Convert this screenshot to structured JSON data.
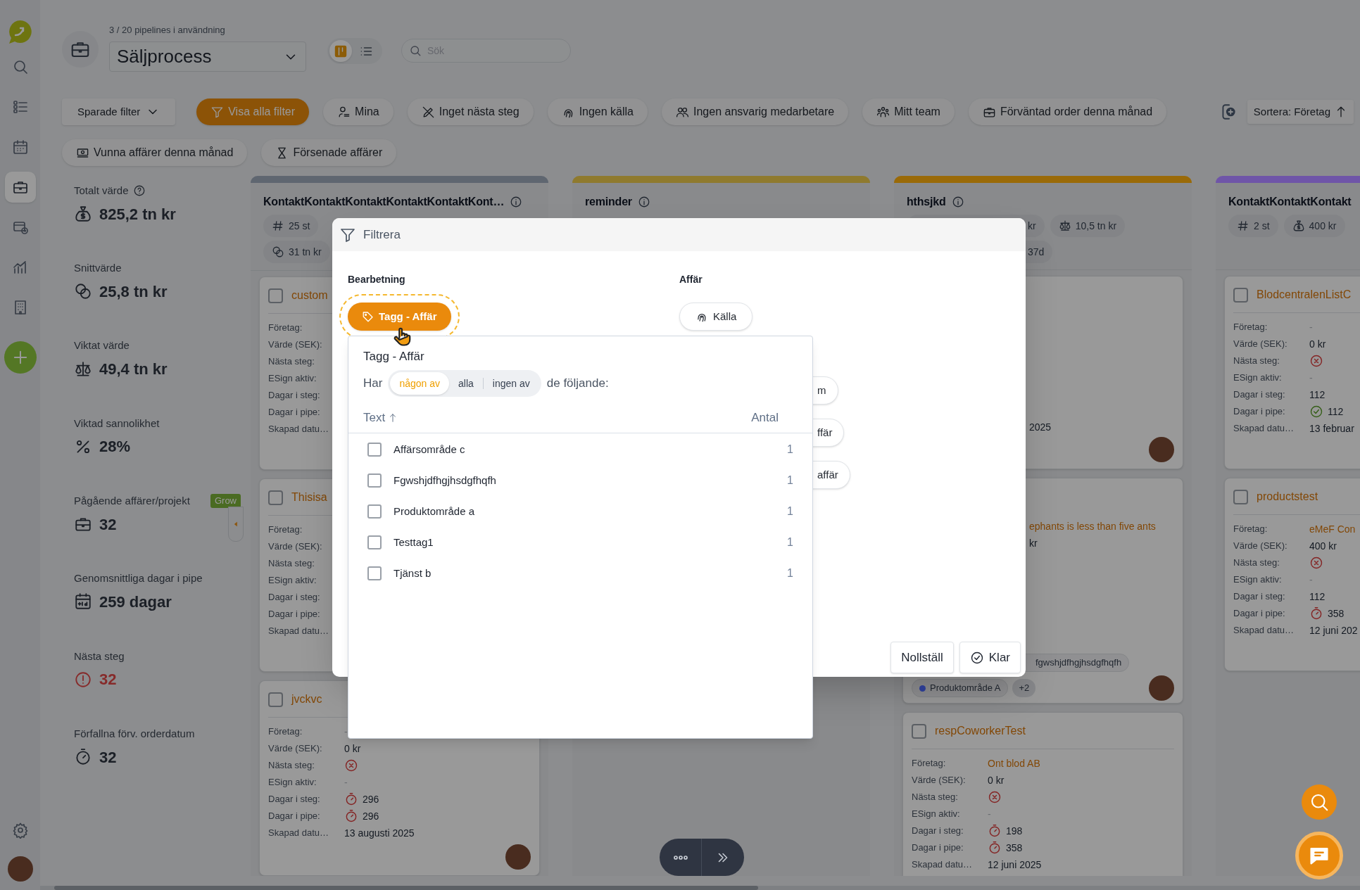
{
  "nav": {
    "items": [
      {
        "kind": "search",
        "selected": false
      },
      {
        "kind": "tasks",
        "selected": false
      },
      {
        "kind": "calendar",
        "selected": false
      },
      {
        "kind": "pipeline",
        "selected": true
      },
      {
        "kind": "mail",
        "selected": false
      },
      {
        "kind": "reports",
        "selected": false
      },
      {
        "kind": "companies",
        "selected": false
      }
    ]
  },
  "header": {
    "usage": "3 / 20 pipelines i användning",
    "pipeline": "Säljprocess",
    "views": [
      {
        "kind": "board",
        "selected": true
      },
      {
        "kind": "list",
        "selected": false
      }
    ],
    "search": {
      "placeholder": "Sök"
    }
  },
  "filter_rows": [
    {
      "chips": [
        {
          "kind": "saved",
          "label": "Sparade filter",
          "selected": false
        },
        {
          "kind": "all",
          "label": "Visa alla filter",
          "selected": true
        },
        {
          "kind": "mine",
          "label": "Mina",
          "selected": false
        },
        {
          "kind": "no_step",
          "label": "Inget nästa steg",
          "selected": false
        },
        {
          "kind": "no_source",
          "label": "Ingen källa",
          "selected": false
        },
        {
          "kind": "no_owner",
          "label": "Ingen ansvarig medarbetare",
          "selected": false
        },
        {
          "kind": "team",
          "label": "Mitt team",
          "selected": false
        },
        {
          "kind": "expected",
          "label": "Förväntad order denna månad",
          "selected": false
        }
      ]
    },
    {
      "chips": [
        {
          "kind": "won",
          "label": "Vunna affärer denna månad",
          "selected": false
        },
        {
          "kind": "late",
          "label": "Försenade affärer",
          "selected": false
        }
      ]
    }
  ],
  "sort": {
    "label": "Sortera: Företag"
  },
  "stats": [
    {
      "kind": "total",
      "label": "Totalt värde",
      "value": "825,2 tn kr",
      "help": true
    },
    {
      "kind": "avg",
      "label": "Snittvärde",
      "value": "25,8 tn kr",
      "help": false
    },
    {
      "kind": "weighted",
      "label": "Viktat värde",
      "value": "49,4 tn kr",
      "help": false
    },
    {
      "kind": "probability",
      "label": "Viktad sannolikhet",
      "value": "28%",
      "help": false
    },
    {
      "kind": "ongoing",
      "label": "Pågående affärer/projekt",
      "value": "32",
      "help": false,
      "badge": "Grow"
    },
    {
      "kind": "days",
      "label": "Genomsnittliga dagar i pipe",
      "value": "259 dagar",
      "help": false
    },
    {
      "kind": "next_step",
      "label": "Nästa steg",
      "value": "32",
      "help": false
    },
    {
      "kind": "overdue",
      "label": "Förfallna förv. orderdatum",
      "value": "32",
      "help": false
    }
  ],
  "columns": [
    {
      "title": "KontaktKontaktKontaktKontaktKontaktKont…",
      "info": true,
      "color": "#5f6670",
      "chip_rows": [
        {
          "chips": [
            {
              "kind": "count",
              "text": "25 st"
            }
          ]
        },
        {
          "chips": [
            {
              "kind": "avg",
              "text": "31 tn kr"
            }
          ]
        }
      ],
      "cards": [
        {
          "kind": "deal",
          "title": "custom",
          "checked": false,
          "avatar": false,
          "fields": [
            {
              "label": "Företag:"
            },
            {
              "label": "Värde (SEK):"
            },
            {
              "label": "Nästa steg:"
            },
            {
              "label": "ESign aktiv:"
            },
            {
              "label": "Dagar i steg:"
            },
            {
              "label": "Dagar i pipe:"
            },
            {
              "label": "Skapad datu…"
            }
          ]
        },
        {
          "kind": "deal",
          "title": "Thisisa",
          "checked": false,
          "avatar": false,
          "fields": [
            {
              "label": "Företag:"
            },
            {
              "label": "Värde (SEK):"
            },
            {
              "label": "Nästa steg:"
            },
            {
              "label": "ESign aktiv:"
            },
            {
              "label": "Dagar i steg:"
            },
            {
              "label": "Dagar i pipe:"
            },
            {
              "label": "Skapad datu…"
            }
          ]
        },
        {
          "kind": "deal",
          "title": "jvckvc",
          "checked": false,
          "avatar": true,
          "fields": [
            {
              "label": "Företag:",
              "kind": "muted",
              "value": "-"
            },
            {
              "label": "Värde (SEK):",
              "kind": "text",
              "value": "0 kr"
            },
            {
              "label": "Nästa steg:",
              "kind": "missing"
            },
            {
              "label": "ESign aktiv:",
              "kind": "muted",
              "value": "-"
            },
            {
              "label": "Dagar i steg:",
              "kind": "late",
              "value": "296"
            },
            {
              "label": "Dagar i pipe:",
              "kind": "late",
              "value": "296"
            },
            {
              "label": "Skapad datu…",
              "kind": "text",
              "value": "13 augusti 2025"
            }
          ]
        }
      ]
    },
    {
      "title": "reminder",
      "info": true,
      "color": "#8f7a2e"
    },
    {
      "title": "hthsjkd",
      "info": true,
      "color": "#9a6a08",
      "chip_rows": [
        {
          "chips": [
            {
              "kind": "cut",
              "text": "kr"
            },
            {
              "kind": "weighted",
              "text": "10,5 tn kr"
            }
          ]
        },
        {
          "chips": [
            {
              "kind": "cut",
              "text": "37d"
            }
          ]
        }
      ],
      "cards": [
        {
          "kind": "covered",
          "tail": "2025",
          "avatar": true
        },
        {
          "kind": "covered",
          "lines": [
            {
              "kind": "link",
              "text": "ephants is less than five ants"
            },
            {
              "kind": "text",
              "text": "kr"
            }
          ],
          "tag_rows": [
            {
              "tags": [
                {
                  "kind": "cut",
                  "text": "fgwshjdfhgjhsdgfhqfh"
                }
              ]
            },
            {
              "tags": [
                {
                  "kind": "dot",
                  "text": "Produktområde A",
                  "color": "#2b3b8f"
                },
                {
                  "kind": "more",
                  "text": "+2"
                }
              ]
            }
          ],
          "avatar": true
        },
        {
          "kind": "deal",
          "title": "respCoworkerTest",
          "checked": false,
          "avatar": false,
          "fields": [
            {
              "label": "Företag:",
              "kind": "link",
              "value": "Ont blod AB"
            },
            {
              "label": "Värde (SEK):",
              "kind": "text",
              "value": "0 kr"
            },
            {
              "label": "Nästa steg:",
              "kind": "missing"
            },
            {
              "label": "ESign aktiv:",
              "kind": "muted",
              "value": "-"
            },
            {
              "label": "Dagar i steg:",
              "kind": "late",
              "value": "198"
            },
            {
              "label": "Dagar i pipe:",
              "kind": "late",
              "value": "358"
            },
            {
              "label": "Skapad datu…",
              "kind": "text",
              "value": "12 juni 2025"
            }
          ]
        }
      ]
    },
    {
      "title": "KontaktKontaktKontakt",
      "info": false,
      "color": "#6f55a8",
      "chip_rows": [
        {
          "chips": [
            {
              "kind": "count",
              "text": "2 st"
            },
            {
              "kind": "value",
              "text": "400 kr"
            }
          ]
        }
      ],
      "cards": [
        {
          "kind": "deal",
          "title": "BlodcentralenListC",
          "checked": false,
          "avatar": false,
          "fields": [
            {
              "label": "Företag:",
              "kind": "muted",
              "value": "-"
            },
            {
              "label": "Värde (SEK):",
              "kind": "text",
              "value": "0 kr"
            },
            {
              "label": "Nästa steg:",
              "kind": "missing"
            },
            {
              "label": "ESign aktiv:",
              "kind": "muted",
              "value": "-"
            },
            {
              "label": "Dagar i steg:",
              "kind": "text",
              "value": "112"
            },
            {
              "label": "Dagar i pipe:",
              "kind": "ok",
              "value": "112"
            },
            {
              "label": "Skapad datu…",
              "kind": "text",
              "value": "13 februar"
            }
          ]
        },
        {
          "kind": "deal",
          "title": "productstest",
          "checked": false,
          "avatar": false,
          "fields": [
            {
              "label": "Företag:",
              "kind": "link",
              "value": "eMeF Con"
            },
            {
              "label": "Värde (SEK):",
              "kind": "text",
              "value": "400 kr"
            },
            {
              "label": "Nästa steg:",
              "kind": "missing"
            },
            {
              "label": "ESign aktiv:",
              "kind": "muted",
              "value": "-"
            },
            {
              "label": "Dagar i steg:",
              "kind": "text",
              "value": "112"
            },
            {
              "label": "Dagar i pipe:",
              "kind": "late",
              "value": "358"
            },
            {
              "label": "Skapad datu…",
              "kind": "text",
              "value": "12 juni 202"
            }
          ]
        }
      ]
    }
  ],
  "filter_dialog": {
    "title": "Filtrera",
    "sections": [
      {
        "heading": "Bearbetning",
        "chips": [
          {
            "kind": "tag",
            "label": "Tagg - Affär",
            "selected": true
          }
        ]
      },
      {
        "heading": "Affär",
        "chips": [
          {
            "kind": "source",
            "label": "Källa",
            "selected": false
          },
          {
            "kind": "cut",
            "label": "m",
            "selected": false
          },
          {
            "kind": "cut",
            "label": "ffär",
            "selected": false
          },
          {
            "kind": "cut",
            "label": "affär",
            "selected": false
          }
        ]
      }
    ],
    "buttons": [
      {
        "kind": "reset",
        "label": "Nollställ"
      },
      {
        "kind": "done",
        "label": "Klar"
      }
    ]
  },
  "tag_popover": {
    "title": "Tagg - Affär",
    "prefix": "Har",
    "modes": [
      {
        "label": "någon av",
        "selected": true
      },
      {
        "label": "alla",
        "selected": false
      },
      {
        "label": "ingen av",
        "selected": false
      }
    ],
    "suffix": "de följande:",
    "columns": [
      {
        "label": "Text",
        "sorted": true
      },
      {
        "label": "Antal",
        "sorted": false
      }
    ],
    "rows": [
      {
        "text": "Affärsområde c",
        "count": "1",
        "checked": false
      },
      {
        "text": "Fgwshjdfhgjhsdgfhqfh",
        "count": "1",
        "checked": false
      },
      {
        "text": "Produktområde a",
        "count": "1",
        "checked": false
      },
      {
        "text": "Testtag1",
        "count": "1",
        "checked": false
      },
      {
        "text": "Tjänst b",
        "count": "1",
        "checked": false
      }
    ]
  }
}
